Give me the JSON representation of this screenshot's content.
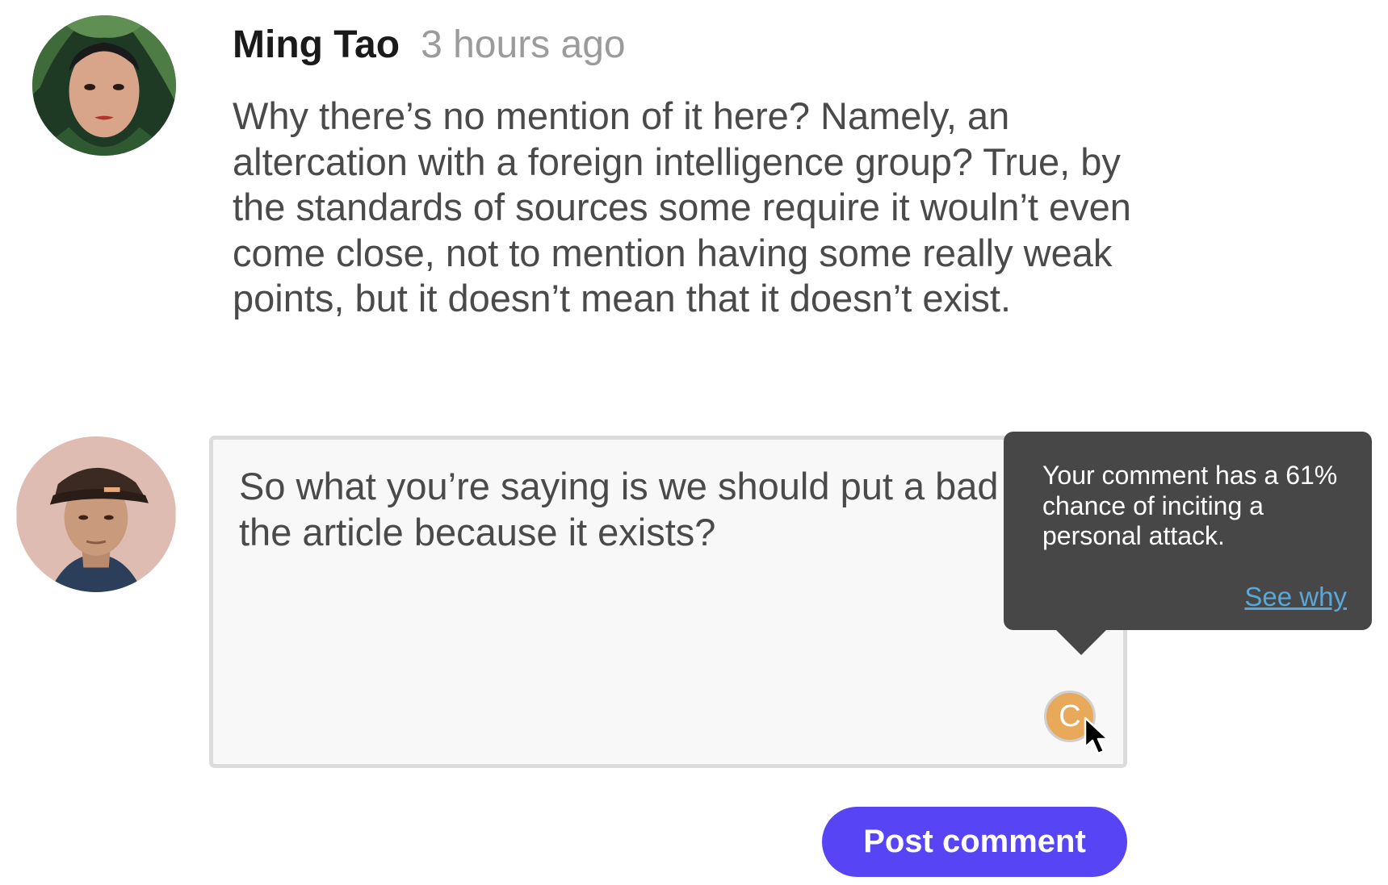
{
  "comment": {
    "author": "Ming Tao",
    "timestamp": "3 hours ago",
    "body": "Why there’s no mention of it here? Namely, an altercation with a foreign intelligence group? True, by the standards of sources some require it wouln’t even come close, not to mention having some really weak points, but it doesn’t mean that it doesn’t exist."
  },
  "reply": {
    "draft_text": "So what you’re saying is we should put a bad source in the article because it exists?",
    "coach_badge_label": "C"
  },
  "tooltip": {
    "message": "Your comment has a 61% chance of inciting a personal attack.",
    "link_label": "See why"
  },
  "actions": {
    "post_label": "Post comment"
  },
  "colors": {
    "accent": "#5745f5",
    "tooltip_bg": "#474747",
    "badge": "#e9a95a",
    "link": "#5aa7d8"
  }
}
